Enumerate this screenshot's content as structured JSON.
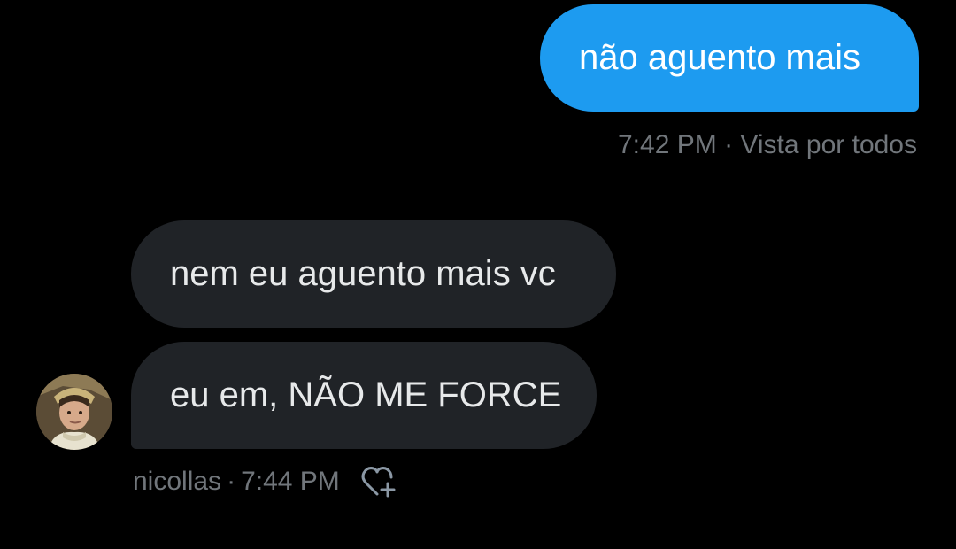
{
  "messages": [
    {
      "direction": "sent",
      "text": "não aguento mais",
      "meta": {
        "time": "7:42 PM",
        "separator": "·",
        "status": "Vista por todos"
      }
    },
    {
      "direction": "received",
      "text": "nem eu aguento mais vc"
    },
    {
      "direction": "received",
      "text": "eu em, NÃO ME FORCE",
      "meta": {
        "sender": "nicollas",
        "separator": "·",
        "time": "7:44 PM"
      }
    }
  ],
  "icons": {
    "avatar": "user-avatar",
    "like": "heart-plus-icon"
  },
  "colors": {
    "background": "#000000",
    "sent_bubble": "#1d9bf0",
    "received_bubble": "#202327",
    "meta_text": "#71767b"
  }
}
